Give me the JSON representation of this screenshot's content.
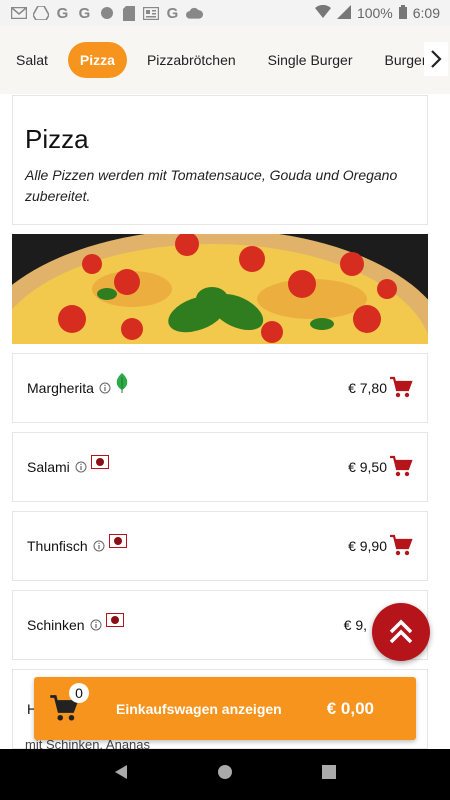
{
  "status_bar": {
    "battery": "100%",
    "time": "6:09",
    "icons": [
      "gmail-icon",
      "drive-icon",
      "google-icon",
      "google-icon",
      "circle-icon",
      "sd-card-icon",
      "news-icon",
      "google-icon",
      "cloud-icon"
    ]
  },
  "categories": [
    {
      "label": "Salat",
      "active": false
    },
    {
      "label": "Pizza",
      "active": true
    },
    {
      "label": "Pizzabrötchen",
      "active": false
    },
    {
      "label": "Single Burger",
      "active": false
    },
    {
      "label": "Burger",
      "active": false
    }
  ],
  "section": {
    "title": "Pizza",
    "description": "Alle Pizzen werden mit Tomatensauce, Gouda und Oregano zubereitet."
  },
  "items": [
    {
      "name": "Margherita",
      "price": "€ 7,80",
      "tag": "leaf-icon"
    },
    {
      "name": "Salami",
      "price": "€ 9,50",
      "tag": "flag-icon"
    },
    {
      "name": "Thunfisch",
      "price": "€ 9,90",
      "tag": "flag-icon"
    },
    {
      "name": "Schinken",
      "price": "€ 9,",
      "tag": "flag-icon"
    },
    {
      "name": "H",
      "price": "",
      "desc": "mit Schinken, Ananas"
    }
  ],
  "cart": {
    "count": "0",
    "label": "Einkaufswagen anzeigen",
    "total": "€ 0,00"
  },
  "colors": {
    "accent": "#f7941d",
    "cart_icon": "#b5141a",
    "fab": "#b5141a",
    "leaf": "#2eaa4a"
  }
}
